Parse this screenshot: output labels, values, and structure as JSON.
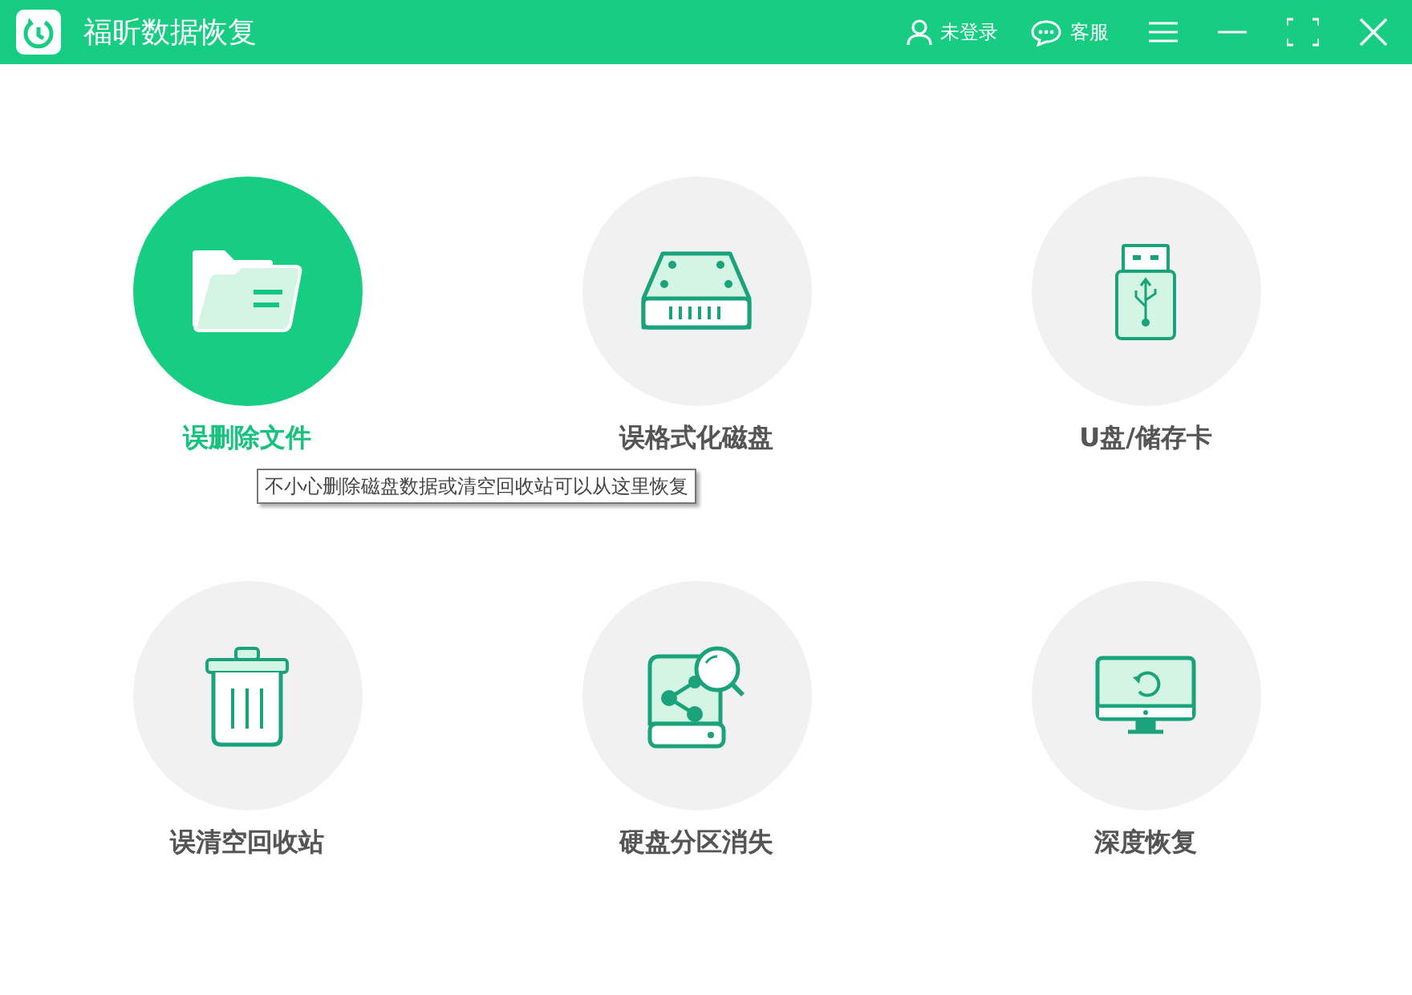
{
  "window": {
    "title": "福昕数据恢复"
  },
  "header_actions": [
    {
      "kind": "user",
      "label": "未登录"
    },
    {
      "kind": "chat",
      "label": "客服"
    }
  ],
  "tiles": [
    {
      "kind": "folder",
      "label": "误删除文件",
      "selected": true
    },
    {
      "kind": "drive",
      "label": "误格式化磁盘",
      "selected": false
    },
    {
      "kind": "usb",
      "label": "U盘/储存卡",
      "selected": false
    },
    {
      "kind": "trash",
      "label": "误清空回收站",
      "selected": false
    },
    {
      "kind": "partition",
      "label": "硬盘分区消失",
      "selected": false
    },
    {
      "kind": "monitor",
      "label": "深度恢复",
      "selected": false
    }
  ],
  "tooltip": {
    "text": "不小心删除磁盘数据或清空回收站可以从这里恢复"
  }
}
